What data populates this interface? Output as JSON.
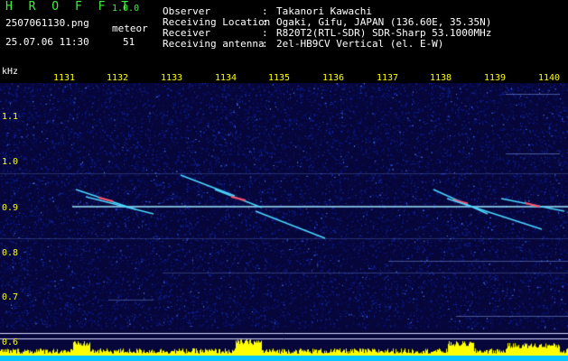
{
  "app": {
    "title": "H R O F F T",
    "version": "1.0.0"
  },
  "capture": {
    "filename": "2507061130.png",
    "datetime": "25.07.06 11:30",
    "meteor_label": "meteor",
    "meteor_count": "51"
  },
  "metadata": [
    {
      "key": "Observer",
      "value": "Takanori Kawachi"
    },
    {
      "key": "Receiving Location",
      "value": "Ogaki, Gifu, JAPAN (136.60E, 35.35N)"
    },
    {
      "key": "Receiver",
      "value": "R820T2(RTL-SDR) SDR-Sharp 53.1000MHz"
    },
    {
      "key": "Receiving antenna",
      "value": "2el-HB9CV Vertical (el. E-W)"
    }
  ],
  "colon": ":",
  "y_axis": {
    "unit": "kHz",
    "ticks": [
      "1.1",
      "1.0",
      "0.9",
      "0.8",
      "0.7",
      "0.6"
    ]
  },
  "x_axis": {
    "ticks": [
      "1131",
      "1132",
      "1133",
      "1134",
      "1135",
      "1136",
      "1137",
      "1138",
      "1139",
      "1140"
    ]
  },
  "colors": {
    "background": "#000000",
    "spectrogram_bg": "#06063a",
    "noise": "#1a2fb0",
    "carrier": "#9ee6ff",
    "echo": "#4ad6ff",
    "echo_hot": "#ff4d6a",
    "power_bar": "#ffff00",
    "power_base": "#00c8ff",
    "guide_line": "#d8d8ff",
    "text_white": "#ffffff",
    "text_green": "#3df23d",
    "text_yellow": "#ffff00"
  }
}
